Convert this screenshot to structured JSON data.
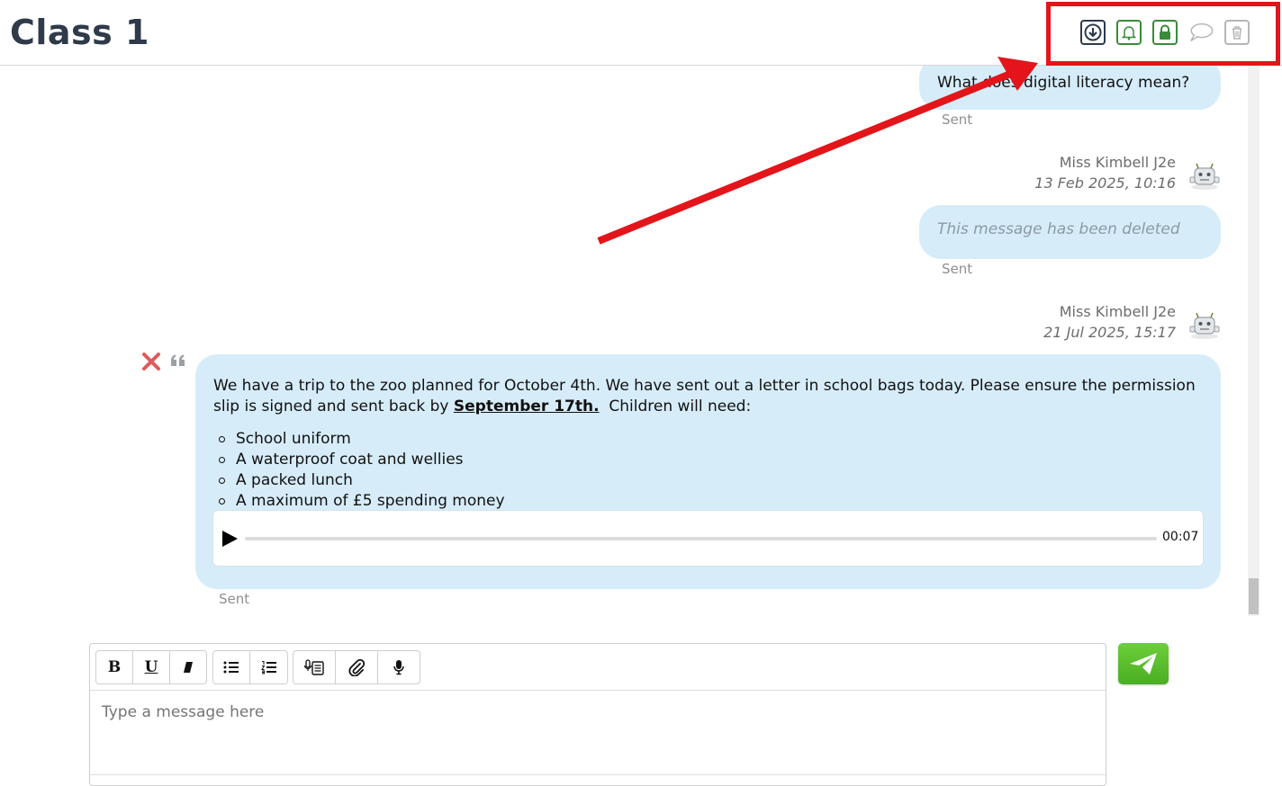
{
  "header": {
    "title": "Class 1",
    "icons": [
      "download-icon",
      "bell-icon",
      "lock-icon",
      "comment-icon",
      "trash-icon"
    ]
  },
  "messages": [
    {
      "text": "What does digital literacy mean?",
      "status": "Sent"
    },
    {
      "author": "Miss Kimbell J2e",
      "timestamp": "13 Feb 2025, 10:16",
      "text": "This message has been deleted",
      "status": "Sent"
    },
    {
      "author": "Miss Kimbell J2e",
      "timestamp": "21 Jul 2025, 15:17",
      "body_part1": "We have a trip to the zoo planned for October 4th. We have sent out a letter in school bags today. Please ensure the permission slip is signed and sent back by ",
      "body_bold": "September 17th.",
      "body_part2": "  Children will need:",
      "list": [
        "School uniform",
        "A waterproof coat and wellies",
        "A packed lunch",
        "A maximum of £5 spending money"
      ],
      "audio_duration": "00:07",
      "audio_progress": 0,
      "status": "Sent"
    }
  ],
  "composer": {
    "placeholder": "Type a message here",
    "bold_label": "B",
    "underline_label": "U"
  },
  "colors": {
    "bubble": "#d6ecf9",
    "accent_red": "#e3151a",
    "send_green": "#5cbf2a",
    "title": "#2f3a4a"
  }
}
